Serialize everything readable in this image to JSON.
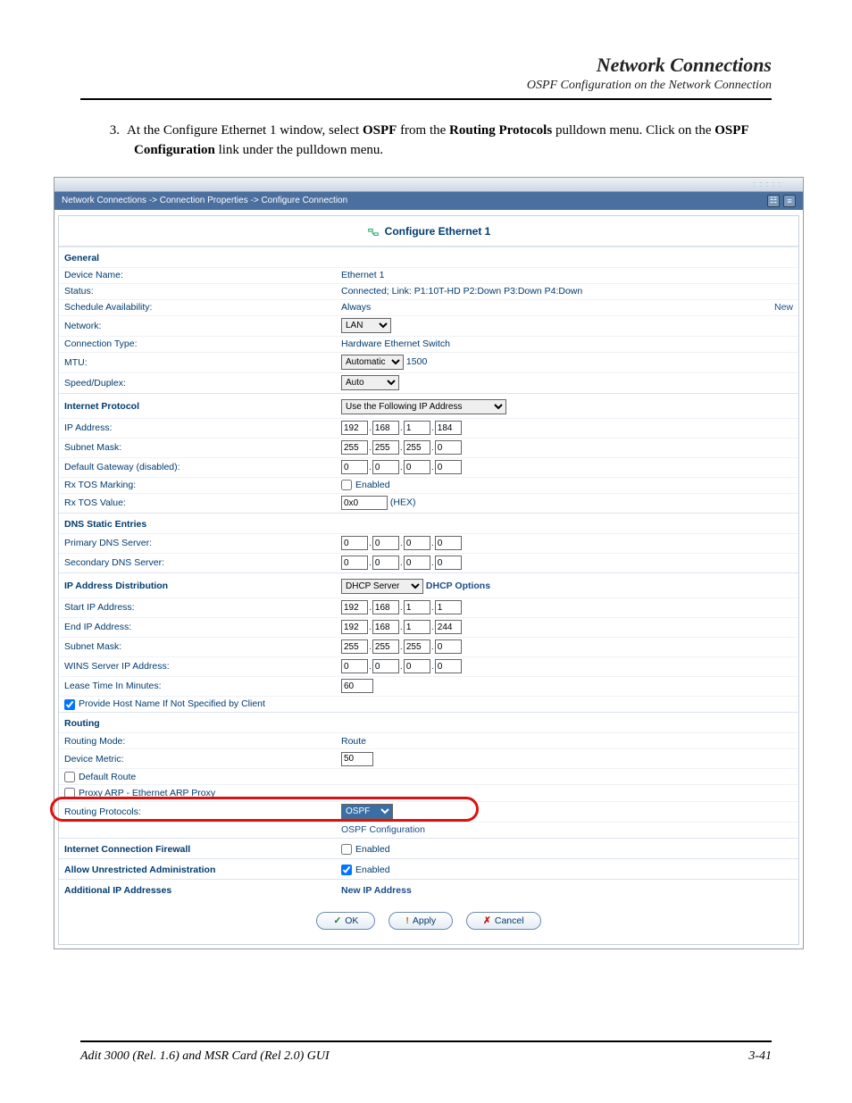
{
  "header": {
    "title": "Network Connections",
    "subtitle": "OSPF Configuration on the Network Connection"
  },
  "instruction": {
    "number": "3.",
    "text_a": "At the Configure Ethernet 1 window, select ",
    "bold_a": "OSPF",
    "text_b": " from the ",
    "bold_b": "Routing Protocols",
    "text_c": " pulldown menu. Click on the ",
    "bold_c": "OSPF Configuration",
    "text_d": " link under the pulldown menu."
  },
  "breadcrumb": "Network Connections -> Connection Properties -> Configure Connection",
  "panel_title": "Configure Ethernet 1",
  "sections": {
    "general": "General",
    "ip": "Internet Protocol",
    "dns": "DNS Static Entries",
    "dist": "IP Address Distribution",
    "routing": "Routing",
    "fw": "Internet Connection Firewall",
    "admin": "Allow Unrestricted Administration",
    "addl": "Additional IP Addresses"
  },
  "labels": {
    "device_name": "Device Name:",
    "status": "Status:",
    "sched": "Schedule Availability:",
    "network": "Network:",
    "conn_type": "Connection Type:",
    "mtu": "MTU:",
    "speed": "Speed/Duplex:",
    "ip_addr": "IP Address:",
    "subnet": "Subnet Mask:",
    "gateway": "Default Gateway (disabled):",
    "rx_mark": "Rx TOS Marking:",
    "rx_val": "Rx TOS Value:",
    "pri_dns": "Primary DNS Server:",
    "sec_dns": "Secondary DNS Server:",
    "start_ip": "Start IP Address:",
    "end_ip": "End IP Address:",
    "subnet2": "Subnet Mask:",
    "wins": "WINS Server IP Address:",
    "lease": "Lease Time In Minutes:",
    "provide_host": "Provide Host Name If Not Specified by Client",
    "routing_mode": "Routing Mode:",
    "device_metric": "Device Metric:",
    "default_route": "Default Route",
    "proxy_arp": "Proxy ARP - Ethernet ARP Proxy",
    "routing_protocols": "Routing Protocols:",
    "ospf_conf": "OSPF Configuration",
    "enabled": "Enabled",
    "hex": "(HEX)",
    "new": "New",
    "new_ip": "New IP Address",
    "dhcp_opts": "DHCP Options"
  },
  "values": {
    "device_name": "Ethernet 1",
    "status": "Connected; Link: P1:10T-HD P2:Down P3:Down P4:Down",
    "sched": "Always",
    "network": "LAN",
    "conn_type": "Hardware Ethernet Switch",
    "mtu_mode": "Automatic",
    "mtu_val": "1500",
    "speed": "Auto",
    "ip_method": "Use the Following IP Address",
    "ip": [
      "192",
      "168",
      "1",
      "184"
    ],
    "mask": [
      "255",
      "255",
      "255",
      "0"
    ],
    "gateway": [
      "0",
      "0",
      "0",
      "0"
    ],
    "rx_val": "0x0",
    "pri_dns": [
      "0",
      "0",
      "0",
      "0"
    ],
    "sec_dns": [
      "0",
      "0",
      "0",
      "0"
    ],
    "dist_mode": "DHCP Server",
    "start_ip": [
      "192",
      "168",
      "1",
      "1"
    ],
    "end_ip": [
      "192",
      "168",
      "1",
      "244"
    ],
    "mask2": [
      "255",
      "255",
      "255",
      "0"
    ],
    "wins": [
      "0",
      "0",
      "0",
      "0"
    ],
    "lease": "60",
    "routing_mode": "Route",
    "device_metric": "50",
    "routing_protocol": "OSPF"
  },
  "buttons": {
    "ok": "OK",
    "apply": "Apply",
    "cancel": "Cancel"
  },
  "footer": {
    "left": "Adit 3000 (Rel. 1.6) and MSR Card (Rel 2.0) GUI",
    "right": "3-41"
  }
}
